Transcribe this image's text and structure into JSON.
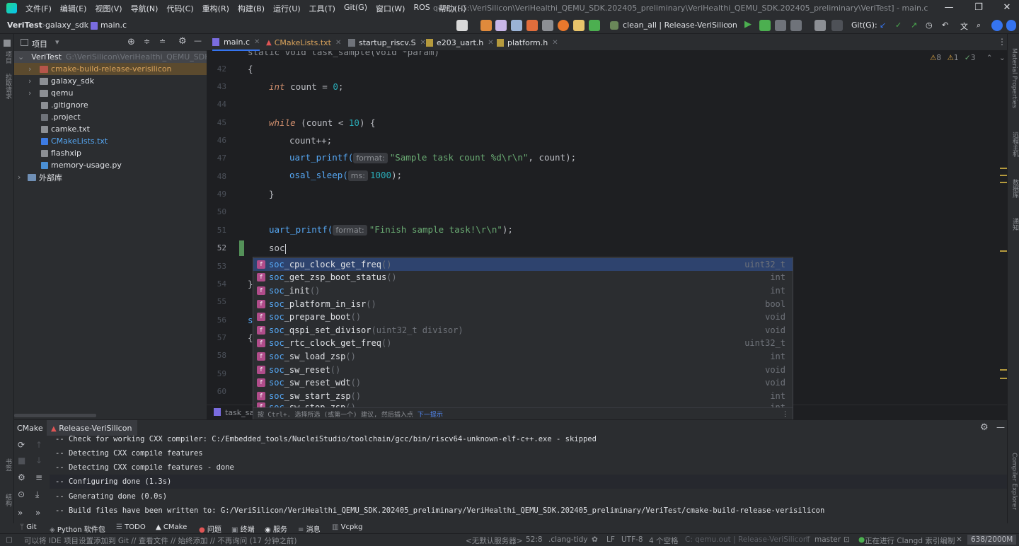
{
  "titlebar": {
    "menu": [
      "文件(F)",
      "编辑(E)",
      "视图(V)",
      "导航(N)",
      "代码(C)",
      "重构(R)",
      "构建(B)",
      "运行(U)",
      "工具(T)",
      "Git(G)",
      "窗口(W)",
      "ROS",
      "帮助(H)"
    ],
    "title": "qemu [G:\\VeriSilicon\\VeriHealthi_QEMU_SDK.202405_preliminary\\VeriHealthi_QEMU_SDK.202405_preliminary\\VeriTest] - main.c"
  },
  "navbar": {
    "project": "VeriTest",
    "folder": "galaxy_sdk",
    "file": "main.c",
    "run_config": "clean_all | Release-VeriSilicon",
    "git_label": "Git(G):"
  },
  "project_panel": {
    "header": "项目",
    "root": "VeriTest",
    "root_path": "G:\\VeriSilicon\\VeriHealthi_QEMU_SDK.2",
    "items": [
      "cmake-build-release-verisilicon",
      "galaxy_sdk",
      "qemu",
      ".gitignore",
      ".project",
      "camke.txt",
      "CMakeLists.txt",
      "flashxip",
      "memory-usage.py"
    ],
    "external": "外部库"
  },
  "tabs": [
    "main.c",
    "CMakeLists.txt",
    "startup_riscv.S",
    "e203_uart.h",
    "platform.h"
  ],
  "inspection": {
    "warn": "8",
    "weak": "1",
    "ok": "3"
  },
  "editor": {
    "line_numbers": [
      "42",
      "43",
      "44",
      "45",
      "46",
      "47",
      "48",
      "49",
      "50",
      "51",
      "52",
      "53",
      "54",
      "55",
      "56",
      "57",
      "58",
      "59",
      "60"
    ],
    "top_line": "static void task_sample(void *param)",
    "l42": "{",
    "l43_kw": "int",
    "l43_rest": " count = ",
    "l43_num": "0",
    "l43_end": ";",
    "l45_kw": "while",
    "l45_a": " (count < ",
    "l45_num": "10",
    "l45_b": ") {",
    "l46": "count++;",
    "l47_fn": "uart_printf(",
    "l47_hint": "format:",
    "l47_str": "\"Sample task count %d\\r\\n\"",
    "l47_end": ", count);",
    "l48_fn": "osal_sleep(",
    "l48_hint": "ms:",
    "l48_num": "1000",
    "l48_end": ");",
    "l49": "}",
    "l51_fn": "uart_printf(",
    "l51_hint": "format:",
    "l51_str": "\"Finish sample task!\\r\\n\"",
    "l51_end": ");",
    "l52": "soc",
    "l54": "}",
    "l56": "s",
    "l57": "{",
    "breadcrumb": "task_sar"
  },
  "completion": {
    "prefix": "soc",
    "items": [
      {
        "rest": "_cpu_clock_get_freq",
        "sig": "()",
        "ret": "uint32_t"
      },
      {
        "rest": "_get_zsp_boot_status",
        "sig": "()",
        "ret": "int"
      },
      {
        "rest": "_init",
        "sig": "()",
        "ret": "int"
      },
      {
        "rest": "_platform_in_isr",
        "sig": "()",
        "ret": "bool"
      },
      {
        "rest": "_prepare_boot",
        "sig": "()",
        "ret": "void"
      },
      {
        "rest": "_qspi_set_divisor",
        "sig": "(uint32_t divisor)",
        "ret": "void"
      },
      {
        "rest": "_rtc_clock_get_freq",
        "sig": "()",
        "ret": "uint32_t"
      },
      {
        "rest": "_sw_load_zsp",
        "sig": "()",
        "ret": "int"
      },
      {
        "rest": "_sw_reset",
        "sig": "()",
        "ret": "void"
      },
      {
        "rest": "_sw_reset_wdt",
        "sig": "()",
        "ret": "void"
      },
      {
        "rest": "_sw_start_zsp",
        "sig": "()",
        "ret": "int"
      },
      {
        "rest": "_sw_stop_zsp",
        "sig": "()",
        "ret": "int"
      }
    ],
    "footer": "按 Ctrl+. 选择所选 (或第一个) 建议, 然后插入点",
    "footer_link": "下一提示"
  },
  "bottom_panel": {
    "tab1": "CMake",
    "tab2": "Release-VeriSilicon",
    "lines": [
      "-- Check for working CXX compiler: C:/Embedded_tools/NucleiStudio/toolchain/gcc/bin/riscv64-unknown-elf-c++.exe - skipped",
      "-- Detecting CXX compile features",
      "-- Detecting CXX compile features - done",
      "-- Configuring done (1.3s)",
      "-- Generating done (0.0s)",
      "-- Build files have been written to: G:/VeriSilicon/VeriHealthi_QEMU_SDK.202405_preliminary/VeriHealthi_QEMU_SDK.202405_preliminary/VeriTest/cmake-build-release-verisilicon"
    ]
  },
  "tool_windows": [
    "Git",
    "Python 软件包",
    "TODO",
    "CMake",
    "问题",
    "终端",
    "服务",
    "消息",
    "Vcpkg"
  ],
  "left_strip": [
    "项目",
    "拉取请求",
    "书签",
    "结构"
  ],
  "right_strip": [
    "Material Properties",
    "远程主机",
    "数据库",
    "通知",
    "Compiler Explorer"
  ],
  "status": {
    "message": "可以将 IDE 项目设置添加到 Git // 查看文件 // 始终添加 // 不再询问 (17 分钟之前)",
    "server": "<无默认服务器>",
    "position": "52:8",
    "linter": ".clang-tidy",
    "line_ending": "LF",
    "encoding": "UTF-8",
    "indent": "4 个空格",
    "context": "C: qemu.out | Release-VeriSilicon",
    "branch": "master",
    "indexing": "正在进行 Clangd 索引编制",
    "memory": "638/2000M"
  }
}
